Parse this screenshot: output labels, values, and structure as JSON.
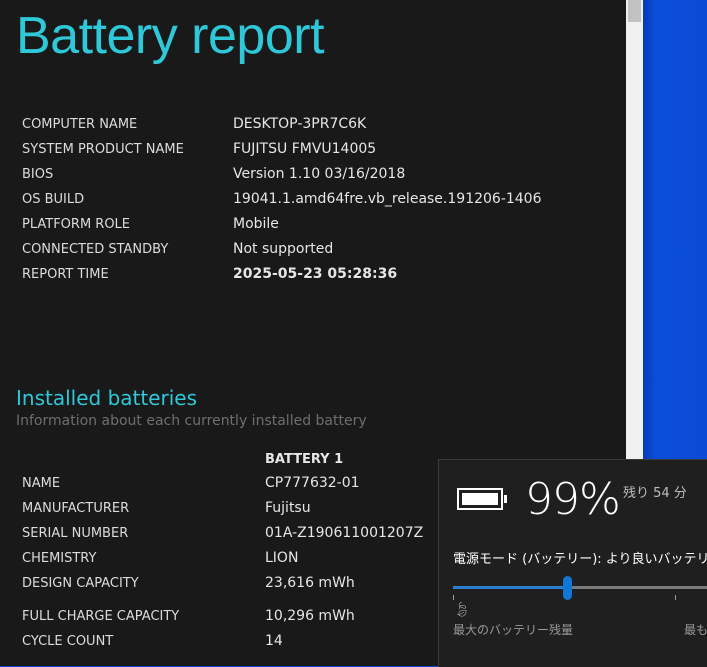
{
  "title": "Battery report",
  "system": [
    {
      "k": "COMPUTER NAME",
      "v": "DESKTOP-3PR7C6K"
    },
    {
      "k": "SYSTEM PRODUCT NAME",
      "v": "FUJITSU FMVU14005"
    },
    {
      "k": "BIOS",
      "v": "Version 1.10 03/16/2018"
    },
    {
      "k": "OS BUILD",
      "v": "19041.1.amd64fre.vb_release.191206-1406"
    },
    {
      "k": "PLATFORM ROLE",
      "v": "Mobile"
    },
    {
      "k": "CONNECTED STANDBY",
      "v": "Not supported"
    },
    {
      "k": "REPORT TIME",
      "v": "2025-05-23  05:28:36"
    }
  ],
  "installed": {
    "heading": "Installed batteries",
    "subtitle": "Information about each currently installed battery",
    "column": "BATTERY 1",
    "rows": [
      {
        "k": "NAME",
        "v": "CP777632-01"
      },
      {
        "k": "MANUFACTURER",
        "v": "Fujitsu"
      },
      {
        "k": "SERIAL NUMBER",
        "v": "01A-Z190611001207Z"
      },
      {
        "k": "CHEMISTRY",
        "v": "LION"
      },
      {
        "k": "DESIGN CAPACITY",
        "v": "23,616 mWh"
      },
      {
        "k": "FULL CHARGE CAPACITY",
        "v": "10,296 mWh"
      },
      {
        "k": "CYCLE COUNT",
        "v": "14"
      }
    ]
  },
  "flyout": {
    "percent": "99%",
    "remaining": "残り 54 分",
    "mode": "電源モード (バッテリー): より良いバッテリー",
    "slider_position": 0.44,
    "left_label": "最大のバッテリー残量",
    "right_label": "最も高",
    "battery_level": 99
  }
}
